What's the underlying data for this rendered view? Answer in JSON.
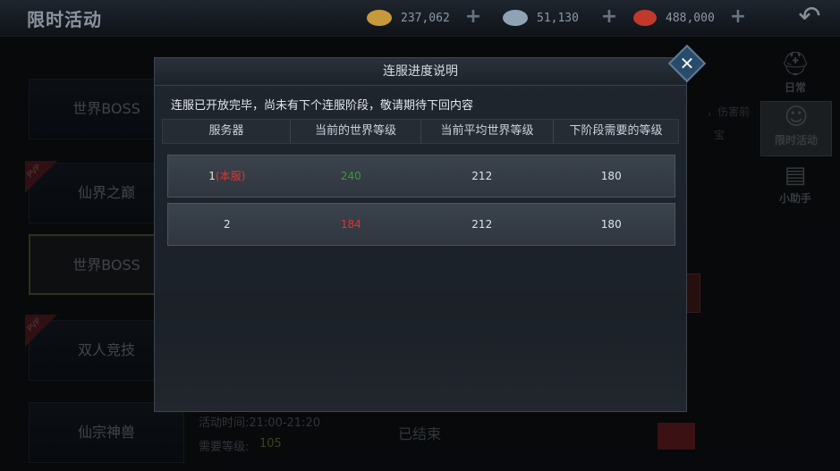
{
  "topbar": {
    "title": "限时活动",
    "currencies": [
      {
        "icon": "gold-ingot-icon",
        "value": "237,062",
        "color": "#c69a3b"
      },
      {
        "icon": "silver-ingot-icon",
        "value": "51,130",
        "color": "#8fa3b5"
      },
      {
        "icon": "red-coins-icon",
        "value": "488,000",
        "color": "#c0392b"
      }
    ],
    "back_icon": "back-arrow-icon"
  },
  "left_menu": {
    "items": [
      {
        "label": "世界BOSS",
        "pvp": false,
        "active": false
      },
      {
        "label": "仙界之巅",
        "pvp": true,
        "active": false
      },
      {
        "label": "世界BOSS",
        "pvp": false,
        "active": true
      },
      {
        "label": "双人竞技",
        "pvp": true,
        "active": false
      },
      {
        "label": "仙宗神兽",
        "pvp": false,
        "active": false
      }
    ],
    "pvp_tag": "PVP"
  },
  "right_menu": {
    "items": [
      {
        "label": "日常",
        "icon": "helmet-icon",
        "active": false
      },
      {
        "label": "限时活动",
        "icon": "hat-icon",
        "active": true
      },
      {
        "label": "小助手",
        "icon": "book-icon",
        "active": false
      }
    ]
  },
  "background": {
    "side_text_1": "，伤害前",
    "side_text_2": "宝",
    "activity_time": "活动时间:21:00-21:20",
    "required_level_label": "需要等级:",
    "required_level_value": "105",
    "ended_label": "已结束"
  },
  "modal": {
    "title": "连服进度说明",
    "notice": "连服已开放完毕，尚未有下个连服阶段，敬请期待下回内容",
    "columns": [
      "服务器",
      "当前的世界等级",
      "当前平均世界等级",
      "下阶段需要的等级"
    ],
    "rows": [
      {
        "server": "1",
        "tag": "(本服)",
        "current_level": "240",
        "current_level_color": "#3a9a3c",
        "avg_level": "212",
        "next_level": "180"
      },
      {
        "server": "2",
        "tag": "",
        "current_level": "184",
        "current_level_color": "#e0352f",
        "avg_level": "212",
        "next_level": "180"
      }
    ],
    "close_icon": "close-icon"
  }
}
